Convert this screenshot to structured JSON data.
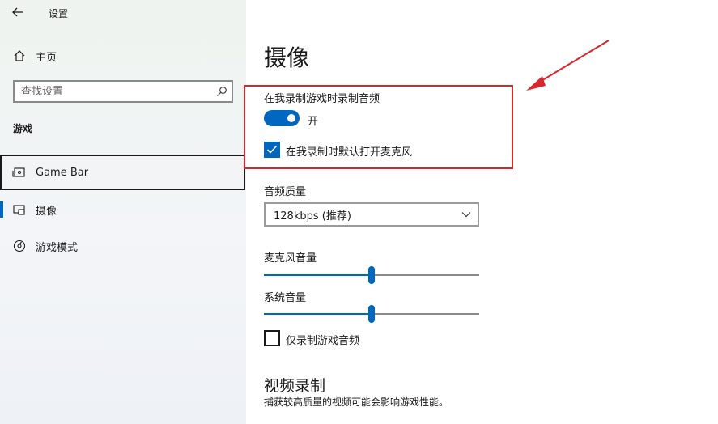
{
  "window": {
    "title": "设置"
  },
  "sidebar": {
    "home_label": "主页",
    "search_placeholder": "查找设置",
    "section_label": "游戏",
    "items": [
      {
        "label": "Game Bar",
        "icon": "game-bar-icon"
      },
      {
        "label": "摄像",
        "icon": "capture-icon",
        "selected": true
      },
      {
        "label": "游戏模式",
        "icon": "game-mode-icon"
      }
    ]
  },
  "main": {
    "title": "摄像",
    "record_audio": {
      "label": "在我录制游戏时录制音频",
      "toggle_state": "开",
      "toggle_on": true,
      "mic_checkbox_label": "在我录制时默认打开麦克风",
      "mic_checkbox_checked": true
    },
    "audio_quality": {
      "label": "音频质量",
      "selected": "128kbps (推荐)"
    },
    "mic_volume": {
      "label": "麦克风音量",
      "value_fraction": 0.5
    },
    "system_volume": {
      "label": "系统音量",
      "value_fraction": 0.5
    },
    "game_audio_only": {
      "label": "仅录制游戏音频",
      "checked": false
    },
    "video_section": {
      "title": "视频录制",
      "description": "捕获较高质量的视频可能会影响游戏性能。"
    }
  },
  "colors": {
    "accent": "#0067c0",
    "annotation": "#d8262d"
  }
}
